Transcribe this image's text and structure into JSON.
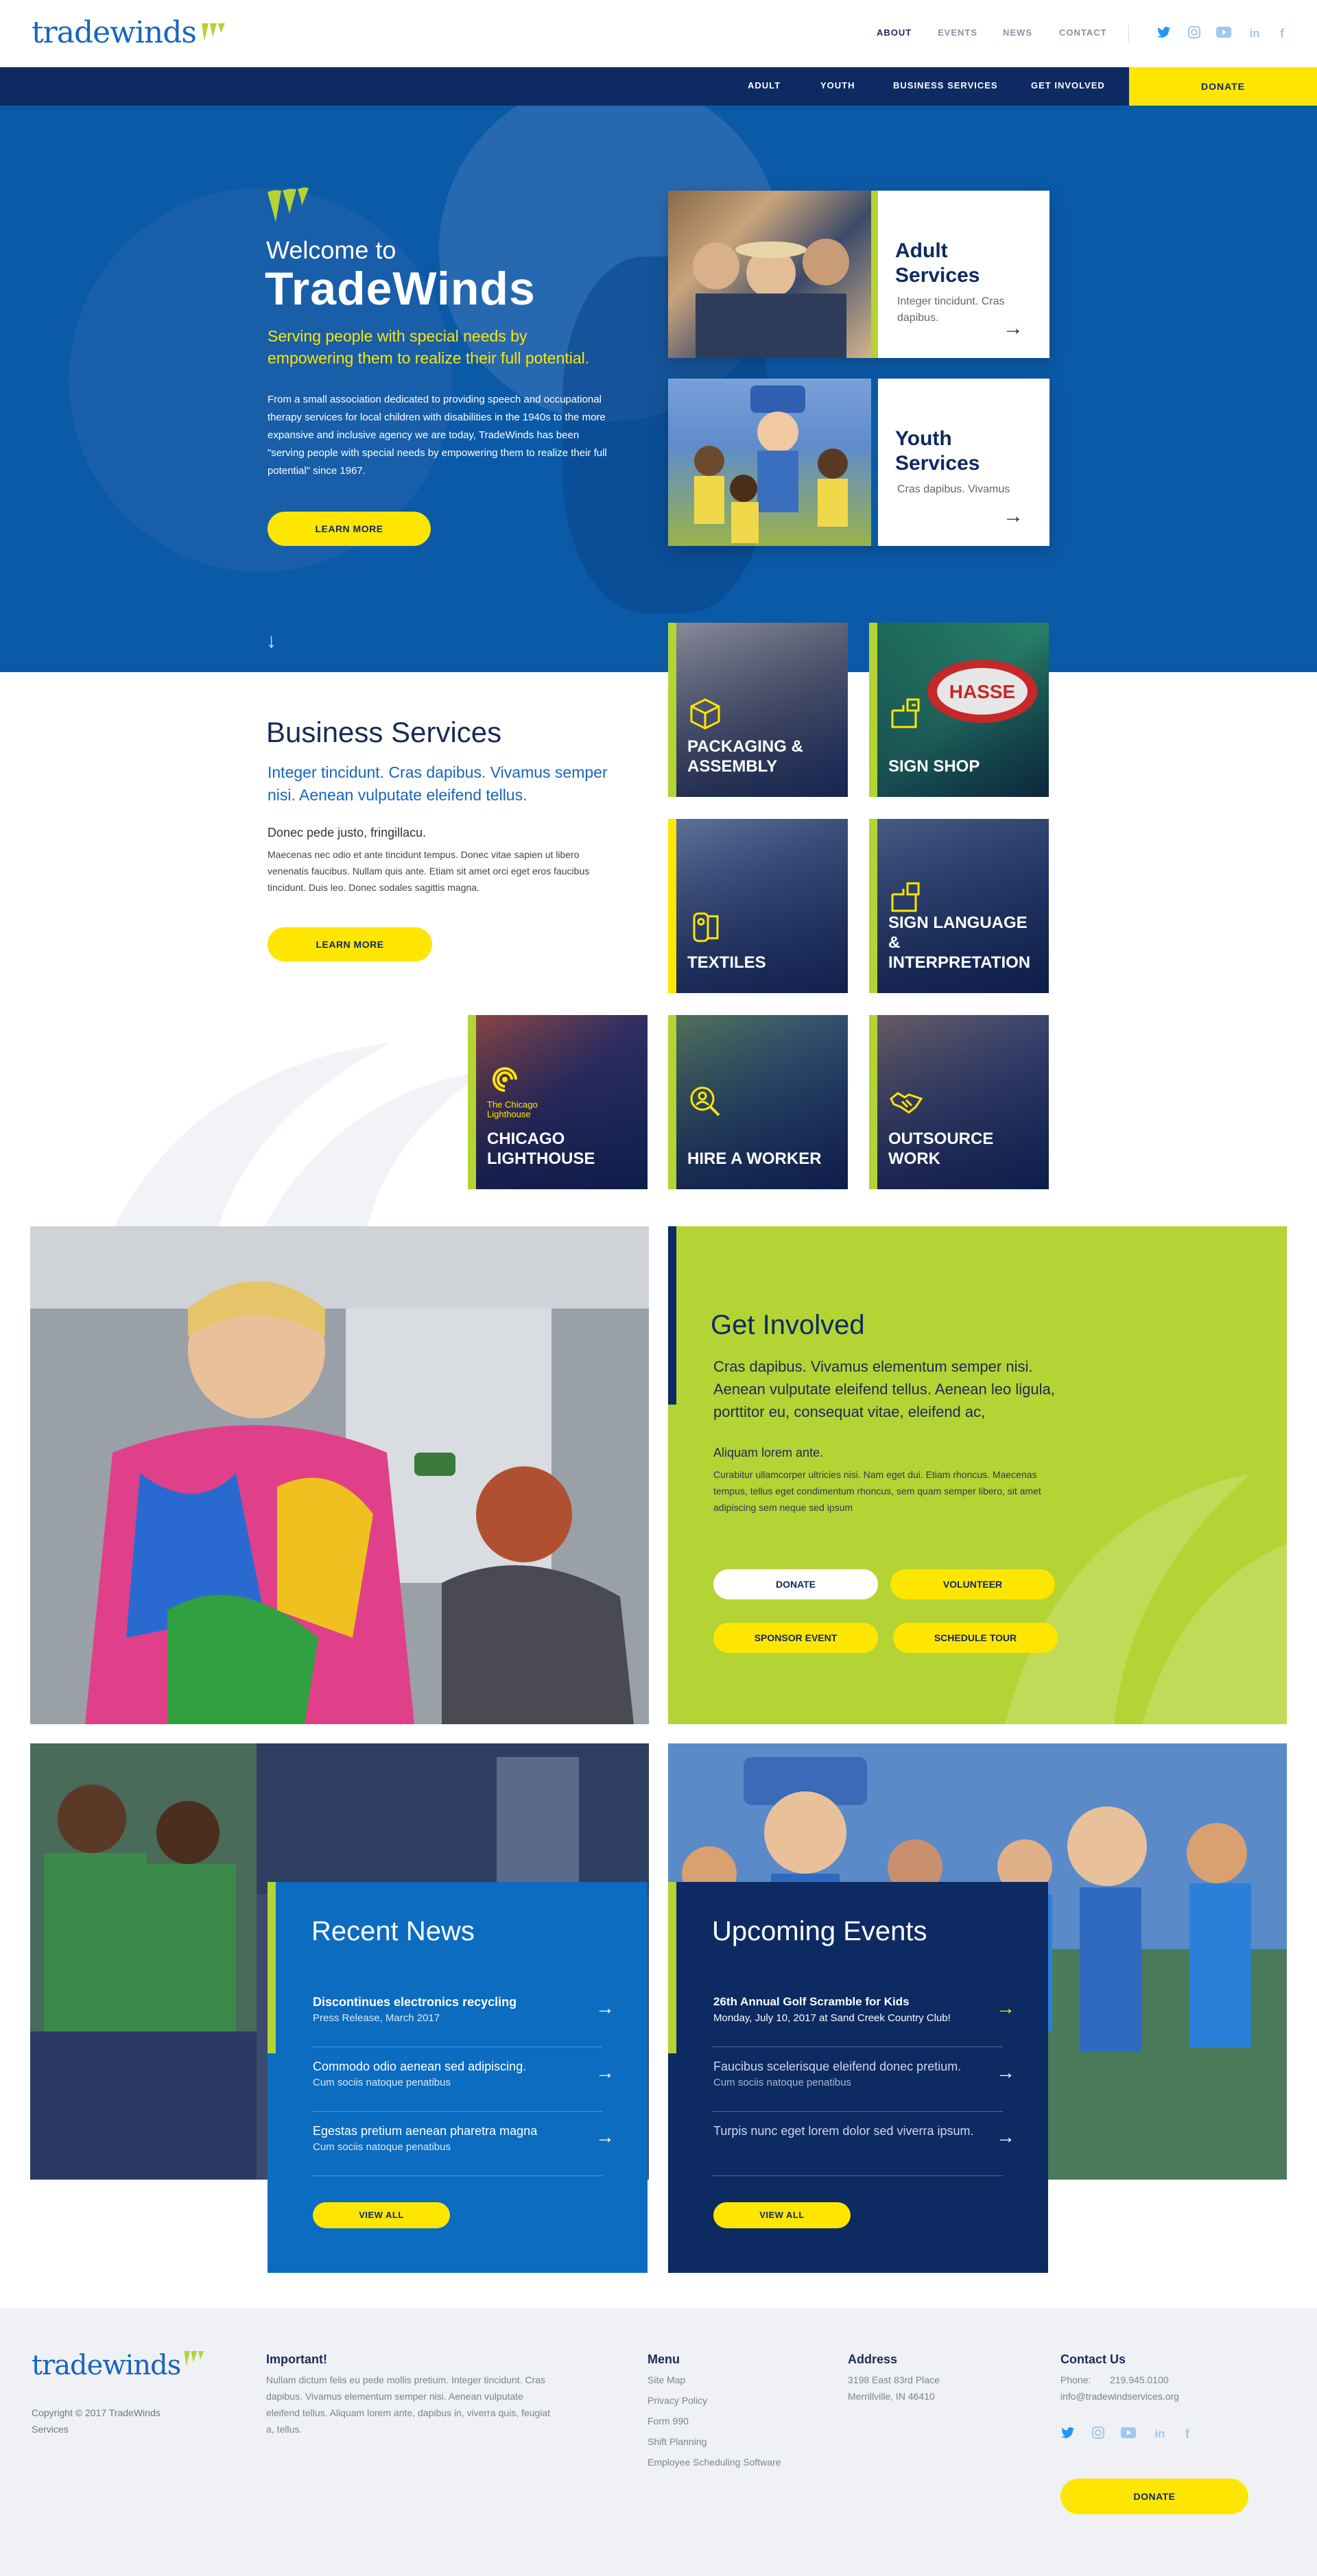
{
  "brand": {
    "logo_text": "tradewinds",
    "accent_blue": "#0b5aa8",
    "navy": "#0d2a62",
    "lime": "#b4d334",
    "yellow": "#ffe600"
  },
  "top_nav": {
    "items": [
      "ABOUT",
      "EVENTS",
      "NEWS",
      "CONTACT"
    ],
    "active": "ABOUT"
  },
  "social": [
    "twitter-icon",
    "instagram-icon",
    "youtube-icon",
    "linkedin-icon",
    "facebook-icon"
  ],
  "sub_nav": {
    "items": [
      "ADULT",
      "YOUTH",
      "BUSINESS SERVICES",
      "GET INVOLVED"
    ],
    "donate": "DONATE"
  },
  "hero": {
    "welcome": "Welcome to",
    "title": "TradeWinds",
    "tagline": "Serving people with special needs by empowering them to realize their full potential.",
    "body": "From a small association dedicated to providing speech and occupational therapy services for local children with disabilities in the 1940s to the more expansive and inclusive agency we are today, TradeWinds has been \"serving people with special needs by empowering them to realize their full potential\" since 1967.",
    "button": "LEARN MORE"
  },
  "services": [
    {
      "title": "Adult Services",
      "desc": "Integer tincidunt. Cras dapibus."
    },
    {
      "title": "Youth Services",
      "desc": "Cras dapibus. Vivamus"
    }
  ],
  "business": {
    "title": "Business Services",
    "subtitle": "Integer tincidunt. Cras dapibus. Vivamus semper nisi. Aenean vulputate eleifend tellus.",
    "lead": "Donec pede justo, fringillacu.",
    "text": "Maecenas nec odio et ante tincidunt tempus. Donec vitae sapien ut libero venenatis faucibus. Nullam quis ante. Etiam sit amet orci eget eros faucibus tincidunt. Duis leo. Donec sodales sagittis magna.",
    "button": "LEARN MORE",
    "tiles": [
      {
        "label": "PACKAGING & ASSEMBLY",
        "icon": "box-icon"
      },
      {
        "label": "SIGN SHOP",
        "icon": "sign-icon"
      },
      {
        "label": "TEXTILES",
        "icon": "fabric-roll-icon"
      },
      {
        "label": "SIGN LANGUAGE & INTERPRETATION",
        "icon": "sign-language-icon"
      },
      {
        "label": "CHICAGO LIGHTHOUSE",
        "icon": "lighthouse-logo",
        "logo_text": "The Chicago Lighthouse"
      },
      {
        "label": "HIRE A WORKER",
        "icon": "worker-search-icon"
      },
      {
        "label": "OUTSOURCE WORK",
        "icon": "handshake-icon"
      }
    ]
  },
  "get_involved": {
    "title": "Get Involved",
    "subtitle": "Cras dapibus. Vivamus elementum semper nisi. Aenean vulputate eleifend tellus. Aenean leo ligula, porttitor eu, consequat vitae, eleifend ac,",
    "lead": "Aliquam lorem ante.",
    "text": "Curabitur ullamcorper ultricies nisi. Nam eget dui. Etiam rhoncus. Maecenas tempus, tellus eget condimentum rhoncus, sem quam semper libero, sit amet adipiscing sem neque sed ipsum",
    "buttons": [
      "DONATE",
      "VOLUNTEER",
      "SPONSOR EVENT",
      "SCHEDULE TOUR"
    ]
  },
  "news": {
    "title": "Recent News",
    "items": [
      {
        "title": "Discontinues electronics recycling",
        "sub": "Press Release, March 2017"
      },
      {
        "title": "Commodo odio aenean sed adipiscing.",
        "sub": "Cum sociis natoque penatibus"
      },
      {
        "title": "Egestas pretium aenean pharetra magna",
        "sub": "Cum sociis natoque penatibus"
      }
    ],
    "button": "VIEW ALL"
  },
  "events": {
    "title": "Upcoming Events",
    "items": [
      {
        "title": "26th Annual Golf Scramble for Kids",
        "sub": "Monday, July 10, 2017 at Sand Creek Country Club!"
      },
      {
        "title": "Faucibus scelerisque eleifend donec pretium.",
        "sub": "Cum sociis natoque penatibus"
      },
      {
        "title": "Turpis nunc eget lorem dolor sed viverra ipsum.",
        "sub": ""
      }
    ],
    "button": "VIEW ALL"
  },
  "footer": {
    "logo_text": "tradewinds",
    "copyright": "Copyright © 2017 TradeWinds Services",
    "important_title": "Important!",
    "important_text": "Nullam dictum felis eu pede mollis pretium. Integer tincidunt. Cras dapibus. Vivamus elementum semper nisi. Aenean vulputate eleifend tellus. Aliquam lorem ante, dapibus in, viverra quis, feugiat a, tellus.",
    "menu_title": "Menu",
    "menu": [
      "Site Map",
      "Privacy Policy",
      "Form 990",
      "Shift Planning",
      "Employee Scheduling Software"
    ],
    "address_title": "Address",
    "address": [
      "3198 East 83rd Place",
      "Merrillville, IN 46410"
    ],
    "contact_title": "Contact Us",
    "phone_label": "Phone:",
    "phone": "219.945.0100",
    "email": "info@tradewindservices.org",
    "donate": "DONATE"
  }
}
